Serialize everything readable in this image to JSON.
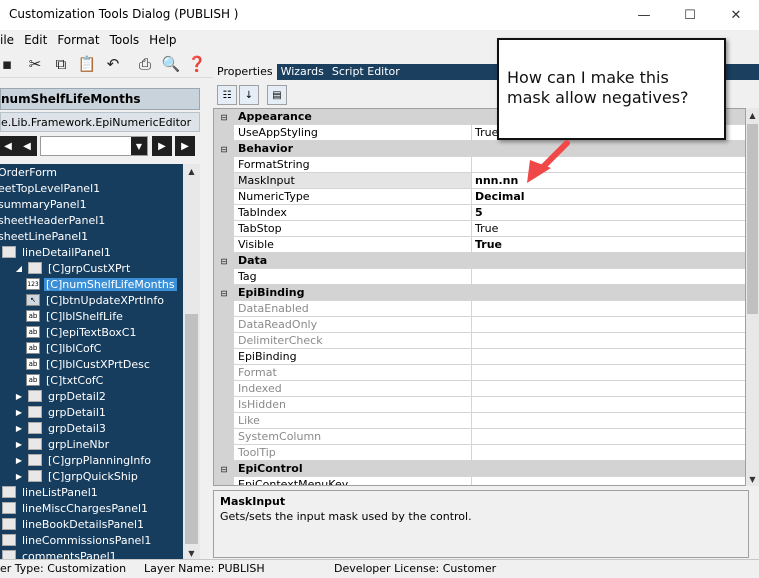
{
  "window": {
    "title": "Customization Tools Dialog  (PUBLISH )",
    "minimize": "—",
    "maximize": "☐",
    "close": "✕"
  },
  "menu": [
    "ile",
    "Edit",
    "Format",
    "Tools",
    "Help"
  ],
  "left": {
    "control_name": "numShelfLifeMonths",
    "control_type": "e.Lib.Framework.EpiNumericEditor",
    "tree": [
      {
        "label": "OrderForm",
        "indent": 0,
        "expander": "",
        "icon": ""
      },
      {
        "label": "eetTopLevelPanel1",
        "indent": 0,
        "expander": "",
        "icon": ""
      },
      {
        "label": "summaryPanel1",
        "indent": 0,
        "expander": "",
        "icon": ""
      },
      {
        "label": "sheetHeaderPanel1",
        "indent": 0,
        "expander": "",
        "icon": ""
      },
      {
        "label": "sheetLinePanel1",
        "indent": 0,
        "expander": "",
        "icon": ""
      },
      {
        "label": "lineDetailPanel1",
        "indent": 1,
        "expander": "",
        "icon": "folder"
      },
      {
        "label": "[C]grpCustXPrt",
        "indent": 2,
        "expander": "◢",
        "icon": "folder"
      },
      {
        "label": "[C]numShelfLifeMonths",
        "indent": 3,
        "expander": "",
        "icon": "num",
        "selected": true
      },
      {
        "label": "[C]btnUpdateXPrtInfo",
        "indent": 3,
        "expander": "",
        "icon": "btn"
      },
      {
        "label": "[C]lblShelfLife",
        "indent": 3,
        "expander": "",
        "icon": "ab"
      },
      {
        "label": "[C]epiTextBoxC1",
        "indent": 3,
        "expander": "",
        "icon": "ab"
      },
      {
        "label": "[C]lblCofC",
        "indent": 3,
        "expander": "",
        "icon": "ab"
      },
      {
        "label": "[C]lblCustXPrtDesc",
        "indent": 3,
        "expander": "",
        "icon": "ab"
      },
      {
        "label": "[C]txtCofC",
        "indent": 3,
        "expander": "",
        "icon": "ab"
      },
      {
        "label": "grpDetail2",
        "indent": 2,
        "expander": "▶",
        "icon": "folder"
      },
      {
        "label": "grpDetail1",
        "indent": 2,
        "expander": "▶",
        "icon": "folder"
      },
      {
        "label": "grpDetail3",
        "indent": 2,
        "expander": "▶",
        "icon": "folder"
      },
      {
        "label": "grpLineNbr",
        "indent": 2,
        "expander": "▶",
        "icon": "folder"
      },
      {
        "label": "[C]grpPlanningInfo",
        "indent": 2,
        "expander": "▶",
        "icon": "folder"
      },
      {
        "label": "[C]grpQuickShip",
        "indent": 2,
        "expander": "▶",
        "icon": "folder"
      },
      {
        "label": "lineListPanel1",
        "indent": 1,
        "expander": "",
        "icon": "folder"
      },
      {
        "label": "lineMiscChargesPanel1",
        "indent": 1,
        "expander": "",
        "icon": "folder"
      },
      {
        "label": "lineBookDetailsPanel1",
        "indent": 1,
        "expander": "",
        "icon": "folder"
      },
      {
        "label": "lineCommissionsPanel1",
        "indent": 1,
        "expander": "",
        "icon": "folder"
      },
      {
        "label": "commentsPanel1",
        "indent": 1,
        "expander": "",
        "icon": "folder"
      }
    ]
  },
  "tabs": [
    "Properties",
    "Wizards",
    "Script Editor"
  ],
  "properties": [
    {
      "name": "Appearance",
      "category": true,
      "gutter": "⊟"
    },
    {
      "name": "UseAppStyling",
      "value": "True"
    },
    {
      "name": "Behavior",
      "category": true,
      "gutter": "⊟"
    },
    {
      "name": "FormatString",
      "value": ""
    },
    {
      "name": "MaskInput",
      "value": "nnn.nn",
      "bold": true,
      "highlight": true
    },
    {
      "name": "NumericType",
      "value": "Decimal",
      "bold": true
    },
    {
      "name": "TabIndex",
      "value": "5",
      "bold": true
    },
    {
      "name": "TabStop",
      "value": "True"
    },
    {
      "name": "Visible",
      "value": "True",
      "bold": true
    },
    {
      "name": "Data",
      "category": true,
      "gutter": "⊟"
    },
    {
      "name": "Tag",
      "value": ""
    },
    {
      "name": "EpiBinding",
      "category": true,
      "gutter": "⊟"
    },
    {
      "name": "DataEnabled",
      "value": "",
      "dim": true
    },
    {
      "name": "DataReadOnly",
      "value": "",
      "dim": true
    },
    {
      "name": "DelimiterCheck",
      "value": "",
      "dim": true
    },
    {
      "name": "EpiBinding",
      "value": ""
    },
    {
      "name": "Format",
      "value": "",
      "dim": true
    },
    {
      "name": "Indexed",
      "value": "",
      "dim": true
    },
    {
      "name": "IsHidden",
      "value": "",
      "dim": true
    },
    {
      "name": "Like",
      "value": "",
      "dim": true
    },
    {
      "name": "SystemColumn",
      "value": "",
      "dim": true
    },
    {
      "name": "ToolTip",
      "value": "",
      "dim": true
    },
    {
      "name": "EpiControl",
      "category": true,
      "gutter": "⊟"
    },
    {
      "name": "EpiContextMenuKey",
      "value": ""
    }
  ],
  "help": {
    "title": "MaskInput",
    "description": "Gets/sets the input mask used by the control."
  },
  "callout": {
    "text": "How can I make this mask allow negatives?"
  },
  "status": {
    "type": "er Type:  Customization",
    "layer": "Layer Name:  PUBLISH",
    "license": "Developer License:  Customer"
  }
}
